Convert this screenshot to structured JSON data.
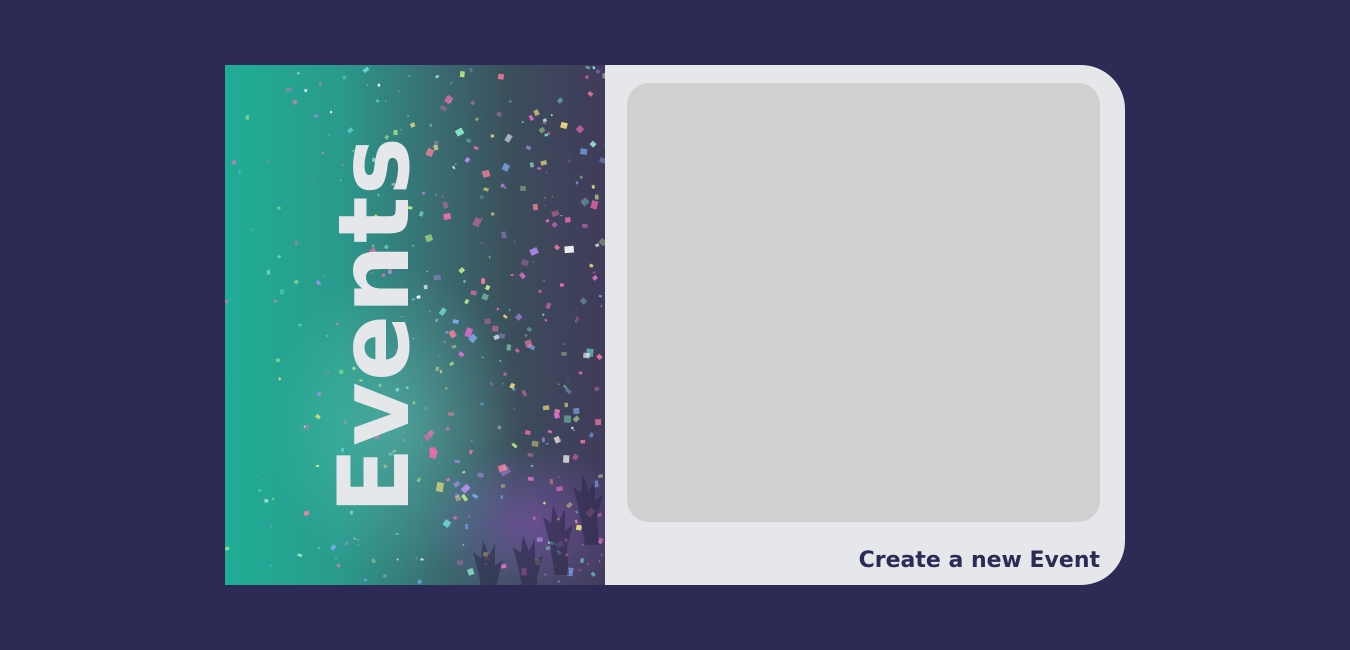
{
  "banner": {
    "title": "Events"
  },
  "panel": {
    "create_label": "Create a new Event"
  },
  "colors": {
    "background": "#2d2a55",
    "panel": "#e6e7ea",
    "placeholder": "#d0d0d0",
    "link_text": "#2d2a55",
    "banner_teal": "#1fae95"
  }
}
